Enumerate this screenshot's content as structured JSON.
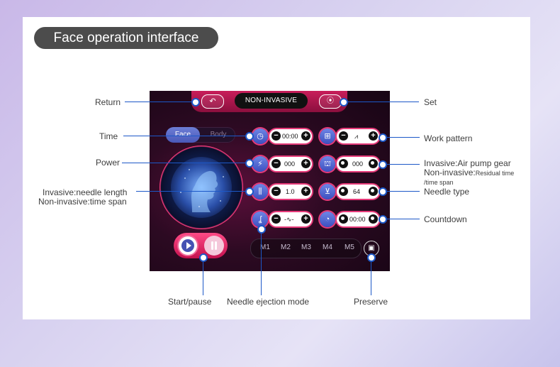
{
  "header": {
    "title": "Face operation interface"
  },
  "screen": {
    "mode": "NON-INVASIVE",
    "return_glyph": "↶",
    "set_glyph": "⦿",
    "tabs": [
      {
        "label": "Face",
        "active": true
      },
      {
        "label": "Body",
        "active": false
      }
    ],
    "controls": {
      "time": {
        "icon": "clock-icon",
        "glyph": "◷",
        "value": "00:00"
      },
      "work_pattern": {
        "icon": "grid-icon",
        "glyph": "⊞",
        "value": "⩘"
      },
      "power": {
        "icon": "lightning-icon",
        "glyph": "⚡",
        "value": "000"
      },
      "air_pump": {
        "icon": "pump-icon",
        "glyph": "⛫",
        "value": "000"
      },
      "needle_length": {
        "icon": "needle-icon",
        "glyph": "⫼",
        "value": "1.0"
      },
      "needle_type": {
        "icon": "needle-type-icon",
        "glyph": "⊻",
        "value": "64"
      },
      "ejection_mode": {
        "icon": "ejection-icon",
        "glyph": "ʆ",
        "value": "-∿-"
      },
      "countdown": {
        "icon": "timer-icon",
        "glyph": "◔",
        "value": "00:00"
      }
    },
    "memory": [
      "M1",
      "M2",
      "M3",
      "M4",
      "M5"
    ],
    "save_glyph": "▣"
  },
  "callouts": {
    "return": "Return",
    "time": "Time",
    "power": "Power",
    "needle_length_1": "Invasive:needle length",
    "needle_length_2": "Non-invasive:time span",
    "set": "Set",
    "work_pattern": "Work pattern",
    "air_pump_1": "Invasive:Air pump gear",
    "air_pump_2": "Non-invasive:",
    "air_pump_2b": "Residual time",
    "air_pump_3": "/time span",
    "needle_type": "Needle type",
    "countdown": "Countdown",
    "start_pause": "Start/pause",
    "needle_ejection": "Needle ejection mode",
    "preserve": "Preserve"
  },
  "colors": {
    "accent": "#e63a79",
    "line": "#1c58c8",
    "icon_blue": "#4a58b8"
  }
}
